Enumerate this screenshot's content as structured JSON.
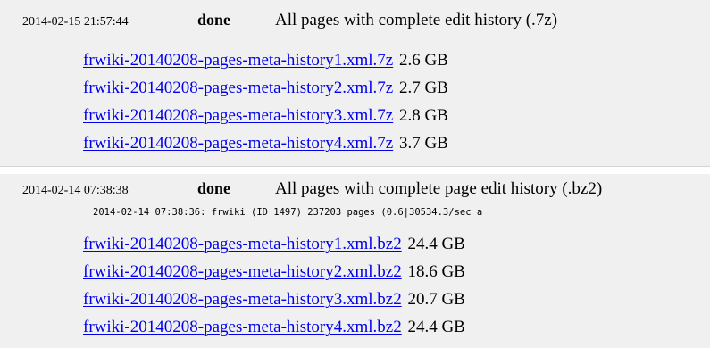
{
  "jobs": [
    {
      "timestamp": "2014-02-15 21:57:44",
      "status": "done",
      "description": "All pages with complete edit history (.7z)",
      "progress": "",
      "files": [
        {
          "name": "frwiki-20140208-pages-meta-history1.xml.7z",
          "size": "2.6 GB"
        },
        {
          "name": "frwiki-20140208-pages-meta-history2.xml.7z",
          "size": "2.7 GB"
        },
        {
          "name": "frwiki-20140208-pages-meta-history3.xml.7z",
          "size": "2.8 GB"
        },
        {
          "name": "frwiki-20140208-pages-meta-history4.xml.7z",
          "size": "3.7 GB"
        }
      ]
    },
    {
      "timestamp": "2014-02-14 07:38:38",
      "status": "done",
      "description": "All pages with complete page edit history (.bz2)",
      "progress": "2014-02-14 07:38:36: frwiki (ID 1497) 237203 pages (0.6|30534.3/sec a",
      "files": [
        {
          "name": "frwiki-20140208-pages-meta-history1.xml.bz2",
          "size": "24.4 GB"
        },
        {
          "name": "frwiki-20140208-pages-meta-history2.xml.bz2",
          "size": "18.6 GB"
        },
        {
          "name": "frwiki-20140208-pages-meta-history3.xml.bz2",
          "size": "20.7 GB"
        },
        {
          "name": "frwiki-20140208-pages-meta-history4.xml.bz2",
          "size": "24.4 GB"
        }
      ]
    }
  ],
  "colors": {
    "link": "#0000ee",
    "section_background": "#f0f0f0"
  }
}
